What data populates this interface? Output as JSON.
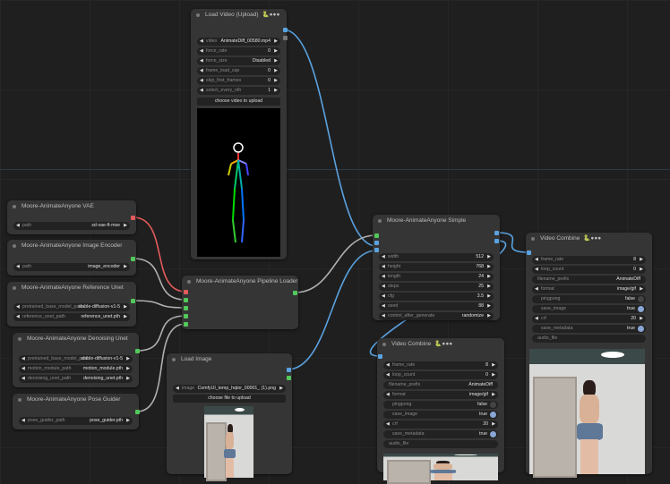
{
  "colors": {
    "model": "#e35b5b",
    "image": "#52c95a",
    "video": "#5aa2e0",
    "background": "#1f1f1f"
  },
  "nodes": [
    {
      "id": "load_video",
      "title": "Load Video (Upload)",
      "badge": "🐍●●●",
      "widgets": [
        {
          "type": "combo",
          "label": "video",
          "value": "AnimateDiff_00580.mp4"
        },
        {
          "type": "number",
          "label": "force_rate",
          "value": "0"
        },
        {
          "type": "combo",
          "label": "force_size",
          "value": "Disabled"
        },
        {
          "type": "number",
          "label": "frame_load_cap",
          "value": "0"
        },
        {
          "type": "number",
          "label": "skip_first_frames",
          "value": "0"
        },
        {
          "type": "number",
          "label": "select_every_nth",
          "value": "1"
        }
      ],
      "button": "choose video to upload"
    },
    {
      "id": "vae",
      "title": "Moore-AnimateAnyone VAE",
      "widgets": [
        {
          "type": "combo",
          "label": "path",
          "value": "sd-vae-ft-mse"
        }
      ]
    },
    {
      "id": "encoder",
      "title": "Moore-AnimateAnyone Image Encoder",
      "widgets": [
        {
          "type": "combo",
          "label": "path",
          "value": "image_encoder"
        }
      ]
    },
    {
      "id": "ref_unet",
      "title": "Moore-AnimateAnyone Reference Unet",
      "widgets": [
        {
          "type": "combo",
          "label": "pretrained_base_model_path",
          "value": "stable-diffusion-v1-5"
        },
        {
          "type": "combo",
          "label": "reference_unet_path",
          "value": "reference_unet.pth"
        }
      ]
    },
    {
      "id": "denoise",
      "title": "Moore-AnimateAnyone Denoising Unet",
      "widgets": [
        {
          "type": "combo",
          "label": "pretrained_base_model_path",
          "value": "stable-diffusion-v1-5"
        },
        {
          "type": "combo",
          "label": "motion_module_path",
          "value": "motion_module.pth"
        },
        {
          "type": "combo",
          "label": "denoising_unet_path",
          "value": "denoising_unet.pth"
        }
      ]
    },
    {
      "id": "pose",
      "title": "Moore-AnimateAnyone Pose Guider",
      "widgets": [
        {
          "type": "combo",
          "label": "pose_guider_path",
          "value": "pose_guider.pth"
        }
      ]
    },
    {
      "id": "pipeline",
      "title": "Moore-AnimateAnyone Pipeline Loader",
      "widgets": []
    },
    {
      "id": "load_image",
      "title": "Load Image",
      "widgets": [
        {
          "type": "combo",
          "label": "image",
          "value": "ComfyUI_temp_hqtor_00001_ (1).png"
        }
      ],
      "button": "choose file to upload"
    },
    {
      "id": "simple",
      "title": "Moore-AnimateAnyone Simple",
      "widgets": [
        {
          "type": "number",
          "label": "width",
          "value": "512"
        },
        {
          "type": "number",
          "label": "height",
          "value": "768"
        },
        {
          "type": "number",
          "label": "length",
          "value": "24"
        },
        {
          "type": "number",
          "label": "steps",
          "value": "25"
        },
        {
          "type": "number",
          "label": "cfg",
          "value": "3.5"
        },
        {
          "type": "number",
          "label": "seed",
          "value": "88"
        },
        {
          "type": "combo",
          "label": "control_after_generate",
          "value": "randomize"
        }
      ]
    },
    {
      "id": "vc1",
      "title": "Video Combine",
      "badge": "🐍●●●",
      "widgets": [
        {
          "type": "number",
          "label": "frame_rate",
          "value": "8"
        },
        {
          "type": "number",
          "label": "loop_count",
          "value": "0"
        },
        {
          "type": "text",
          "label": "filename_prefix",
          "value": "AnimateDiff"
        },
        {
          "type": "combo",
          "label": "format",
          "value": "image/gif"
        },
        {
          "type": "toggle",
          "label": "pingpong",
          "value": "false",
          "on": false
        },
        {
          "type": "toggle",
          "label": "save_image",
          "value": "true",
          "on": true
        },
        {
          "type": "number",
          "label": "crf",
          "value": "20"
        },
        {
          "type": "toggle",
          "label": "save_metadata",
          "value": "true",
          "on": true
        },
        {
          "type": "text",
          "label": "audio_file",
          "value": ""
        }
      ]
    },
    {
      "id": "vc2",
      "title": "Video Combine",
      "badge": "🐍●●●",
      "widgets": [
        {
          "type": "number",
          "label": "frame_rate",
          "value": "8"
        },
        {
          "type": "number",
          "label": "loop_count",
          "value": "0"
        },
        {
          "type": "text",
          "label": "filename_prefix",
          "value": "AnimateDiff"
        },
        {
          "type": "combo",
          "label": "format",
          "value": "image/gif"
        },
        {
          "type": "toggle",
          "label": "pingpong",
          "value": "false",
          "on": false
        },
        {
          "type": "toggle",
          "label": "save_image",
          "value": "true",
          "on": true
        },
        {
          "type": "number",
          "label": "crf",
          "value": "20"
        },
        {
          "type": "toggle",
          "label": "save_metadata",
          "value": "true",
          "on": true
        },
        {
          "type": "text",
          "label": "audio_file",
          "value": ""
        }
      ]
    }
  ]
}
